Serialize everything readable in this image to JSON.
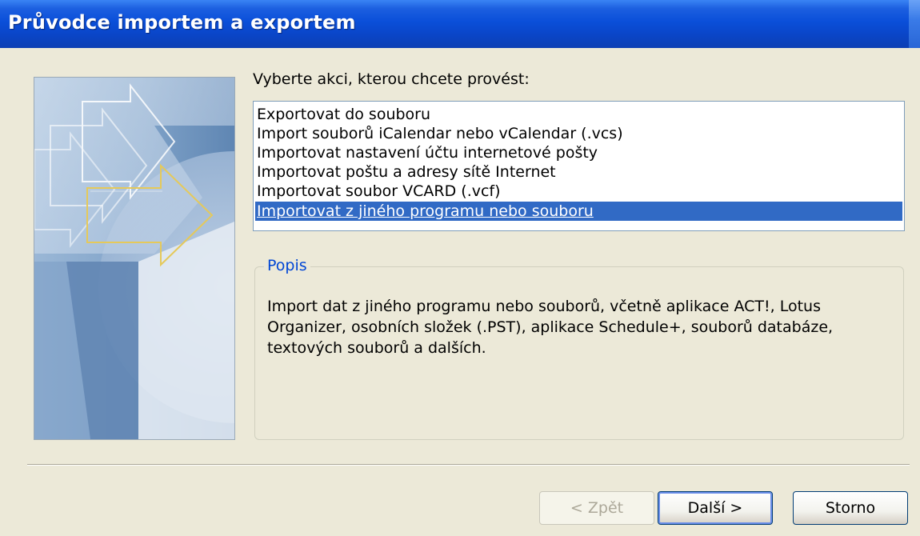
{
  "window": {
    "title": "Průvodce importem a exportem"
  },
  "prompt": "Vyberte akci, kterou chcete provést:",
  "actions": [
    "Exportovat do souboru",
    "Import souborů iCalendar nebo vCalendar (.vcs)",
    "Importovat nastavení účtu internetové pošty",
    "Importovat poštu a adresy sítě Internet",
    "Importovat soubor VCARD (.vcf)",
    "Importovat z jiného programu nebo souboru"
  ],
  "selected_action_index": 5,
  "description": {
    "group_title": "Popis",
    "line1": "Import dat z jiného programu nebo souborů, včetně aplikace ACT!, Lotus",
    "line2": "Organizer, osobních složek (.PST), aplikace Schedule+, souborů databáze,",
    "line3": "textových souborů a dalších."
  },
  "buttons": {
    "back": "< Zpět",
    "next": "Další >",
    "cancel": "Storno"
  },
  "colors": {
    "titlebar": "#0a46c9",
    "dialog_background": "#ece9d8",
    "selection": "#316ac5",
    "group_title": "#0046d5"
  }
}
